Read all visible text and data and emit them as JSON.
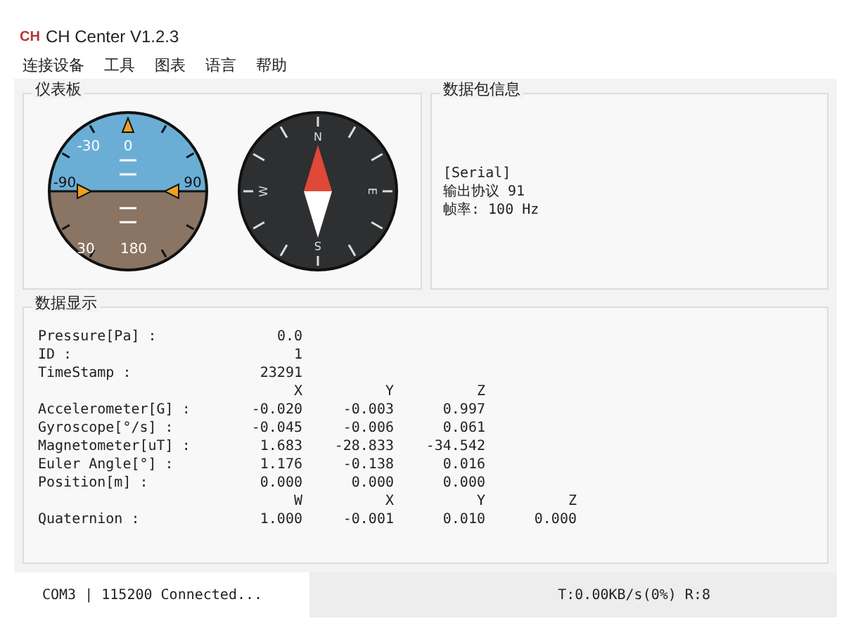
{
  "window": {
    "logo": "CH",
    "title": "CH Center V1.2.3"
  },
  "menu": [
    "连接设备",
    "工具",
    "图表",
    "语言",
    "帮助"
  ],
  "dashboard": {
    "title": "仪表板",
    "attitude": {
      "labels": [
        "-30",
        "0",
        "-90",
        "90",
        "30",
        "180"
      ]
    },
    "compass": {
      "labels": [
        "N",
        "E",
        "S",
        "W"
      ]
    }
  },
  "packet_info": {
    "title": "数据包信息",
    "lines": [
      "[Serial]",
      "输出协议 91",
      "帧率: 100 Hz"
    ]
  },
  "data_display": {
    "title": "数据显示",
    "rows": [
      {
        "kind": "scalar",
        "label": "Pressure[Pa] :",
        "value": "0.0"
      },
      {
        "kind": "scalar",
        "label": "ID :",
        "value": "1"
      },
      {
        "kind": "scalar",
        "label": "TimeStamp :",
        "value": "23291"
      },
      {
        "kind": "header",
        "values": [
          "X",
          "Y",
          "Z"
        ]
      },
      {
        "kind": "vector",
        "label": "Accelerometer[G] :",
        "values": [
          "-0.020",
          "-0.003",
          "0.997"
        ]
      },
      {
        "kind": "vector",
        "label": "Gyroscope[°/s] :",
        "values": [
          "-0.045",
          "-0.006",
          "0.061"
        ]
      },
      {
        "kind": "vector",
        "label": "Magnetometer[uT] :",
        "values": [
          "1.683",
          "-28.833",
          "-34.542"
        ]
      },
      {
        "kind": "vector",
        "label": "Euler Angle[°] :",
        "values": [
          "1.176",
          "-0.138",
          "0.016"
        ]
      },
      {
        "kind": "vector",
        "label": "Position[m] :",
        "values": [
          "0.000",
          "0.000",
          "0.000"
        ]
      },
      {
        "kind": "header",
        "values": [
          "W",
          "X",
          "Y",
          "Z"
        ]
      },
      {
        "kind": "vector",
        "label": "Quaternion :",
        "values": [
          "1.000",
          "-0.001",
          "0.010",
          "0.000"
        ]
      }
    ]
  },
  "status_bar": {
    "connection": "COM3 | 115200 Connected...",
    "throughput": "T:0.00KB/s(0%) R:8"
  }
}
